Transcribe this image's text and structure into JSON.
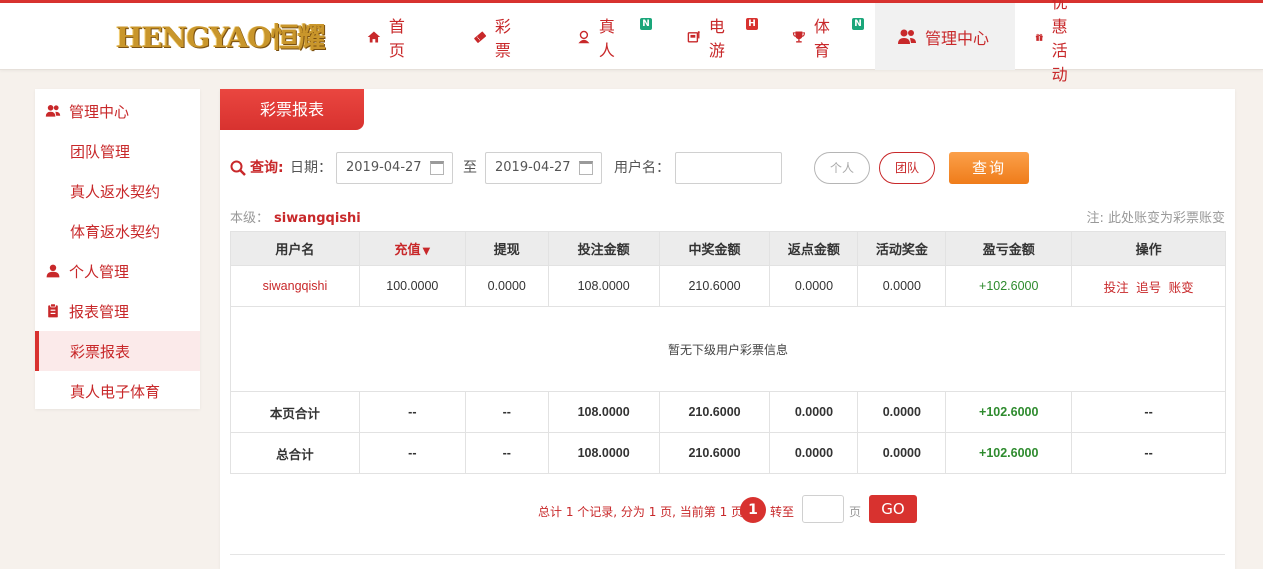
{
  "logo": {
    "text": "HENGYAO恒耀"
  },
  "nav": [
    {
      "label": "首页",
      "icon": "home-icon",
      "badge": ""
    },
    {
      "label": "彩票",
      "icon": "ticket-icon",
      "badge": ""
    },
    {
      "label": "真人",
      "icon": "dealer-icon",
      "badge": "N"
    },
    {
      "label": "电游",
      "icon": "slot-machine-icon",
      "badge": "H"
    },
    {
      "label": "体育",
      "icon": "trophy-icon",
      "badge": "N"
    },
    {
      "label": "管理中心",
      "icon": "users-icon",
      "badge": ""
    },
    {
      "label": "优惠活动",
      "icon": "gift-icon",
      "badge": ""
    }
  ],
  "colors": {
    "brand_red": "#d8322f",
    "badge_green": "#1aa67a",
    "badge_red": "#d8322f",
    "orange": "#ef7c1a"
  },
  "sidebar": {
    "items": [
      {
        "label": "管理中心",
        "type": "group",
        "icon": "users-icon"
      },
      {
        "label": "团队管理",
        "type": "sub"
      },
      {
        "label": "真人返水契约",
        "type": "sub"
      },
      {
        "label": "体育返水契约",
        "type": "sub"
      },
      {
        "label": "个人管理",
        "type": "group",
        "icon": "user-icon"
      },
      {
        "label": "报表管理",
        "type": "group",
        "icon": "report-icon"
      },
      {
        "label": "彩票报表",
        "type": "sub",
        "active": true
      },
      {
        "label": "真人电子体育",
        "type": "sub"
      }
    ]
  },
  "main": {
    "tab_title": "彩票报表",
    "query_label": "查询:",
    "date_label": "日期：",
    "date_from": "2019-04-27",
    "to_label": "至",
    "date_to": "2019-04-27",
    "user_label": "用户名：",
    "username_value": "",
    "btn_personal": "个人",
    "btn_team": "团队",
    "btn_query": "查询",
    "level_label": "本级：",
    "level_value": "siwangqishi",
    "note": "注: 此处账变为彩票账变"
  },
  "table": {
    "headers": [
      "用户名",
      "充值",
      "提现",
      "投注金额",
      "中奖金额",
      "返点金额",
      "活动奖金",
      "盈亏金额",
      "操作"
    ],
    "row": {
      "username": "siwangqishi",
      "deposit": "100.0000",
      "withdraw": "0.0000",
      "bet": "108.0000",
      "win": "210.6000",
      "rebate": "0.0000",
      "bonus": "0.0000",
      "profit": "+102.6000",
      "ops": [
        "投注",
        "追号",
        "账变"
      ]
    },
    "empty_text": "暂无下级用户彩票信息",
    "page_total": {
      "label": "本页合计",
      "deposit": "--",
      "withdraw": "--",
      "bet": "108.0000",
      "win": "210.6000",
      "rebate": "0.0000",
      "bonus": "0.0000",
      "profit": "+102.6000",
      "op": "--"
    },
    "grand_total": {
      "label": "总合计",
      "deposit": "--",
      "withdraw": "--",
      "bet": "108.0000",
      "win": "210.6000",
      "rebate": "0.0000",
      "bonus": "0.0000",
      "profit": "+102.6000",
      "op": "--"
    }
  },
  "pager": {
    "summary": "总计 1 个记录, 分为 1 页, 当前第 1 页",
    "current": "1",
    "goto_label": "转至",
    "page_unit": "页",
    "go_label": "GO"
  }
}
